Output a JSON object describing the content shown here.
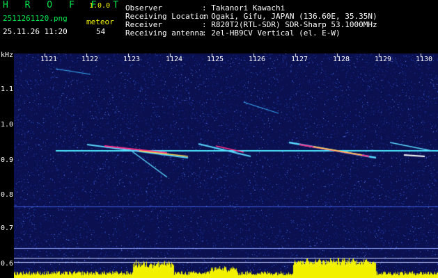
{
  "header": {
    "app_name": "H R O F F T",
    "version": "1.0.0",
    "filename": "2511261120.png",
    "datetime": "25.11.26 11:20",
    "meteor_label": "meteor",
    "meteor_count": "54",
    "info": [
      {
        "label": "Observer",
        "value": ": Takanori Kawachi"
      },
      {
        "label": "Receiving Location",
        "value": ": Ogaki, Gifu, JAPAN (136.60E, 35.35N)"
      },
      {
        "label": "Receiver",
        "value": ": R820T2(RTL-SDR) SDR-Sharp 53.1000MHz"
      },
      {
        "label": "Receiving antenna",
        "value": ": 2el-HB9CV Vertical (el. E-W)"
      }
    ]
  },
  "axis": {
    "y_unit": "kHz",
    "y_ticks": [
      "1.1",
      "1.0",
      "0.9",
      "0.8",
      "0.7",
      "0.6"
    ],
    "x_ticks": [
      "1121",
      "1122",
      "1123",
      "1124",
      "1125",
      "1126",
      "1127",
      "1128",
      "1129",
      "1130"
    ]
  },
  "colors": {
    "background": "#000000",
    "noise": "#1a2d8c",
    "carrier": "#4fe6ff",
    "meteor_core": "#ff2f8a",
    "activity_bar": "#f2f200",
    "title": "#00e64c"
  }
}
